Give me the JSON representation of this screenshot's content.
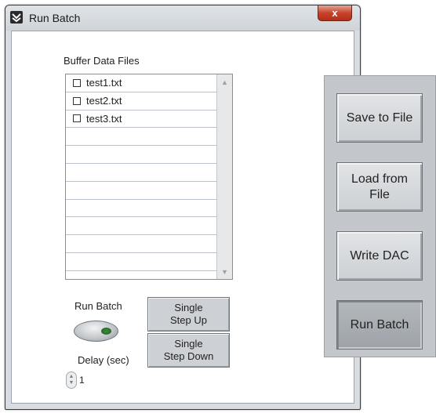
{
  "window": {
    "title": "Run Batch",
    "close_label": "x"
  },
  "file_list": {
    "label": "Buffer Data Files",
    "items": [
      "test1.txt",
      "test2.txt",
      "test3.txt"
    ],
    "checked": [
      false,
      false,
      false
    ],
    "empty_rows": 8
  },
  "run_batch": {
    "label": "Run Batch",
    "toggle_state": "off"
  },
  "step_buttons": {
    "up_line1": "Single",
    "up_line2": "Step Up",
    "down_line1": "Single",
    "down_line2": "Step Down"
  },
  "delay": {
    "label": "Delay (sec)",
    "value": "1"
  },
  "panel": {
    "save": "Save to File",
    "load_line1": "Load from",
    "load_line2": "File",
    "write": "Write DAC",
    "run": "Run Batch"
  },
  "colors": {
    "window_bg": "#d9dde1",
    "close_button": "#c7432b",
    "led_green": "#3f8b3f",
    "panel_bg": "#c3c7cb"
  }
}
